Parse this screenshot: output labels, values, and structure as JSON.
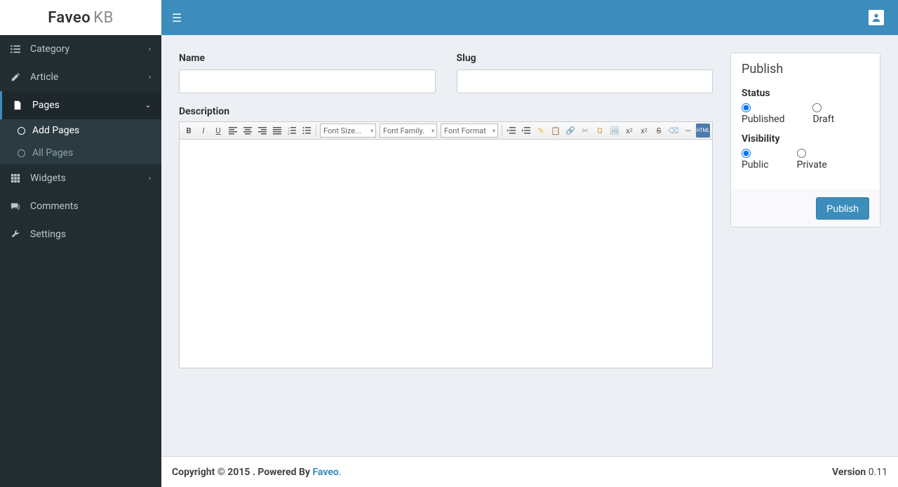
{
  "header": {
    "logo_main": "Faveo",
    "logo_sub": "KB"
  },
  "sidebar": {
    "items": [
      {
        "label": "Category",
        "children": null
      },
      {
        "label": "Article",
        "children": null
      },
      {
        "label": "Pages",
        "children": [
          {
            "label": "Add Pages",
            "active": true
          },
          {
            "label": "All Pages",
            "active": false
          }
        ]
      },
      {
        "label": "Widgets",
        "children": null
      },
      {
        "label": "Comments",
        "children": null
      },
      {
        "label": "Settings",
        "children": null
      }
    ]
  },
  "form": {
    "name_label": "Name",
    "name_value": "",
    "slug_label": "Slug",
    "slug_value": "",
    "description_label": "Description",
    "toolbar": {
      "font_size": "Font Size...",
      "font_family": "Font Family.",
      "font_format": "Font Format"
    }
  },
  "publish": {
    "title": "Publish",
    "status_label": "Status",
    "status_published": "Published",
    "status_draft": "Draft",
    "visibility_label": "Visibility",
    "visibility_public": "Public",
    "visibility_private": "Private",
    "button": "Publish"
  },
  "footer": {
    "copyright_prefix": "Copyright © 2015 . Powered By ",
    "powered_by": "Faveo",
    "suffix": ".",
    "version_label": "Version",
    "version": " 0.11"
  }
}
